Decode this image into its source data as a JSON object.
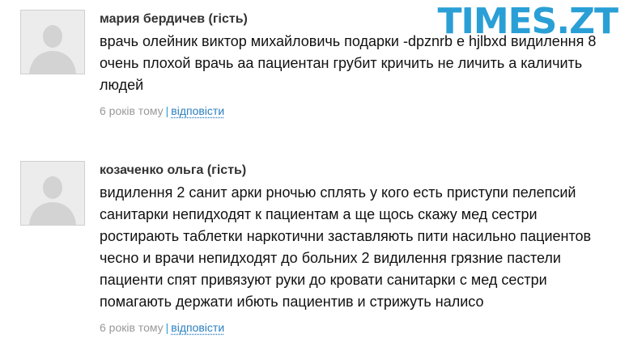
{
  "site": {
    "logo": "TIMES.ZT"
  },
  "comments": [
    {
      "author": "мария бердичев (гість)",
      "text": "врачь олейник виктор михайловичь подарки -dpznrb e hjlbxd видилення 8 очень плохой врачь аа пациентан грубит кричить не личить а каличить людей",
      "time": "6 років тому",
      "separator": "|",
      "reply": "відповісти",
      "avatar_icon": "user-placeholder-icon"
    },
    {
      "author": "козаченко ольга (гість)",
      "text": "видилення 2 санит арки рночью сплять у кого есть приступи пелепсий санитарки непидходят к пациентам а ще щось скажу мед сестри ростирають таблетки наркотични заставляють пити насильно пациентов чесно и врачи непидходят до больних 2 видилення грязние пастели пациенти спят привязуют руки до кровати санитарки с мед сестри помагають держати ибють пациентив и стрижуть налисо",
      "time": "6 років тому",
      "separator": "|",
      "reply": "відповісти",
      "avatar_icon": "user-placeholder-icon"
    }
  ]
}
